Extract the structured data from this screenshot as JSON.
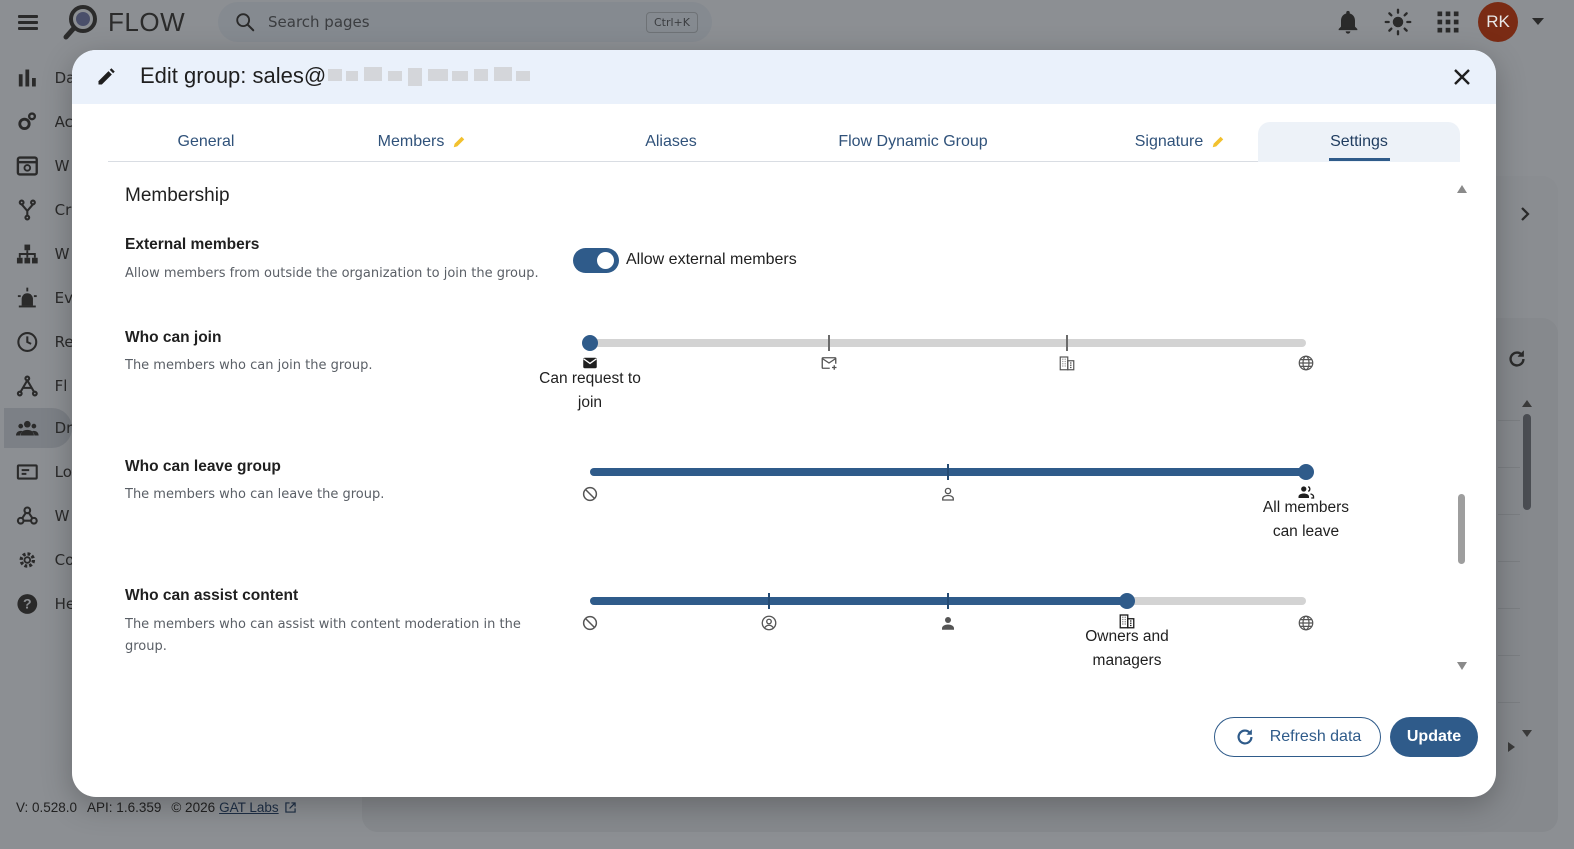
{
  "app": {
    "logo_text": "FLOW",
    "search_placeholder": "Search pages",
    "search_shortcut": "Ctrl+K",
    "avatar_initials": "RK",
    "top_icons": [
      "bell-icon",
      "theme-icon",
      "apps-grid-icon"
    ],
    "sidebar": [
      {
        "label": "Da",
        "icon": "bar-chart-icon"
      },
      {
        "label": "Ac",
        "icon": "cog-multiple-icon"
      },
      {
        "label": "W",
        "icon": "window-icon"
      },
      {
        "label": "Cr",
        "icon": "branch-icon"
      },
      {
        "label": "W",
        "icon": "sitemap-icon"
      },
      {
        "label": "Ev",
        "icon": "alarm-light-icon"
      },
      {
        "label": "Re",
        "icon": "clock-icon"
      },
      {
        "label": "Fl",
        "icon": "flow-icon"
      },
      {
        "label": "Dr",
        "icon": "groups-icon"
      },
      {
        "label": "Lo",
        "icon": "card-icon"
      },
      {
        "label": "W",
        "icon": "webhook-icon"
      },
      {
        "label": "Co",
        "icon": "gear-icon"
      },
      {
        "label": "He",
        "icon": "help-icon"
      }
    ],
    "footer": {
      "version": "V: 0.528.0",
      "api": "API: 1.6.359",
      "copyright": "© 2026",
      "link": "GAT Labs"
    }
  },
  "modal": {
    "title": "Edit group: sales@",
    "tabs": [
      {
        "label": "General"
      },
      {
        "label": "Members",
        "edited": true
      },
      {
        "label": "Aliases"
      },
      {
        "label": "Flow Dynamic Group"
      },
      {
        "label": "Signature",
        "edited": true
      },
      {
        "label": "Settings",
        "active": true
      }
    ],
    "section_title": "Membership",
    "external_members": {
      "title": "External members",
      "description": "Allow members from outside the organization to join the group.",
      "toggle_label": "Allow external members",
      "enabled": true
    },
    "who_can_join": {
      "title": "Who can join",
      "description": "The members who can join the group.",
      "stops": [
        "email-icon",
        "email-plus-icon",
        "domain-icon",
        "globe-icon"
      ],
      "selected_index": 0,
      "selected_label": "Can request to join"
    },
    "who_can_leave": {
      "title": "Who can leave group",
      "description": "The members who can leave the group.",
      "stops": [
        "cancel-icon",
        "person-outline-icon",
        "group-icon"
      ],
      "selected_index": 2,
      "selected_label": "All members can leave"
    },
    "who_can_assist": {
      "title": "Who can assist content",
      "description": "The members who can assist with content moderation in the group.",
      "stops": [
        "cancel-icon",
        "account-circle-icon",
        "person-icon",
        "domain-icon",
        "globe-icon"
      ],
      "selected_index": 3,
      "selected_label": "Owners and managers"
    },
    "buttons": {
      "refresh": "Refresh data",
      "update": "Update"
    },
    "colors": {
      "accent": "#2f5b8a",
      "header_bg": "#eaf1fb",
      "edit_marker": "#f2c12e"
    }
  }
}
